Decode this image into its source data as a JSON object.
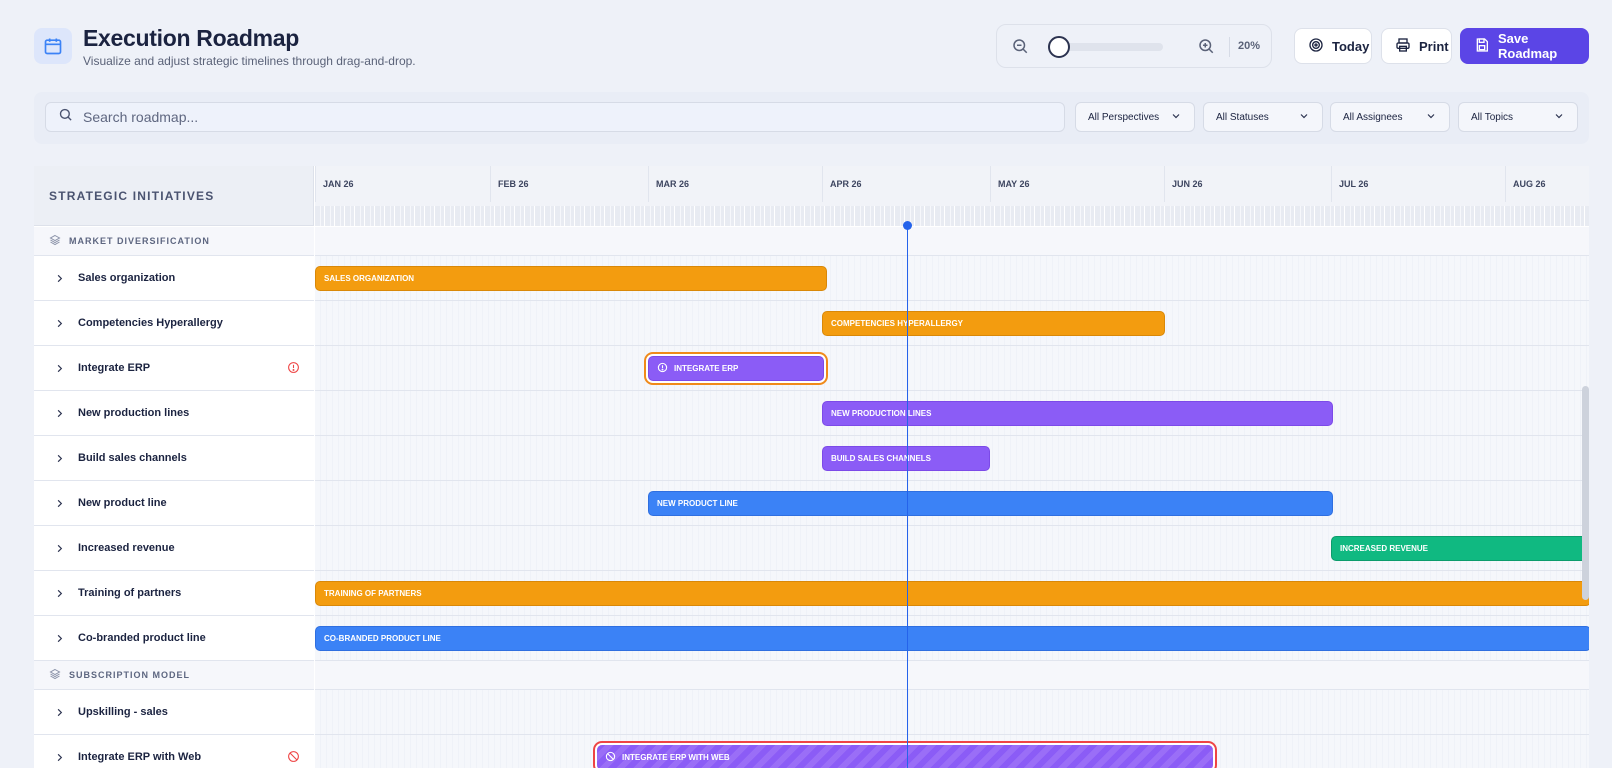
{
  "header": {
    "title": "Execution Roadmap",
    "subtitle": "Visualize and adjust strategic timelines through drag-and-drop."
  },
  "zoom": {
    "value_label": "20%",
    "level": 0.2
  },
  "actions": {
    "today": "Today",
    "print": "Print",
    "save": "Save Roadmap"
  },
  "search": {
    "placeholder": "Search roadmap...",
    "value": ""
  },
  "filters": [
    {
      "label": "All Perspectives"
    },
    {
      "label": "All Statuses"
    },
    {
      "label": "All Assignees"
    },
    {
      "label": "All Topics"
    }
  ],
  "gantt": {
    "left_header": "STRATEGIC INITIATIVES",
    "months": [
      "JAN 26",
      "FEB 26",
      "MAR 26",
      "APR 26",
      "MAY 26",
      "JUN 26",
      "JUL 26",
      "AUG 26"
    ],
    "groups": [
      {
        "name": "MARKET DIVERSIFICATION",
        "rows": [
          {
            "name": "Sales organization",
            "bar_label": "SALES ORGANIZATION",
            "color": "#f39c0f",
            "status": ""
          },
          {
            "name": "Competencies Hyperallergy",
            "bar_label": "COMPETENCIES HYPERALLERGY",
            "color": "#f39c0f",
            "status": ""
          },
          {
            "name": "Integrate ERP",
            "bar_label": "INTEGRATE ERP",
            "color": "#8b5cf6",
            "status": "at-risk"
          },
          {
            "name": "New production lines",
            "bar_label": "NEW PRODUCTION LINES",
            "color": "#8b5cf6",
            "status": ""
          },
          {
            "name": "Build sales channels",
            "bar_label": "BUILD SALES CHANNELS",
            "color": "#8b5cf6",
            "status": ""
          },
          {
            "name": "New product line",
            "bar_label": "NEW PRODUCT LINE",
            "color": "#3b82f6",
            "status": ""
          },
          {
            "name": "Increased revenue",
            "bar_label": "INCREASED REVENUE",
            "color": "#10b981",
            "status": ""
          },
          {
            "name": "Training of partners",
            "bar_label": "TRAINING OF PARTNERS",
            "color": "#f39c0f",
            "status": ""
          },
          {
            "name": "Co-branded product line",
            "bar_label": "CO-BRANDED PRODUCT LINE",
            "color": "#3b82f6",
            "status": ""
          }
        ]
      },
      {
        "name": "SUBSCRIPTION MODEL",
        "rows": [
          {
            "name": "Upskilling - sales",
            "bar_label": "",
            "color": "",
            "status": ""
          },
          {
            "name": "Integrate ERP with Web",
            "bar_label": "INTEGRATE ERP WITH WEB",
            "color": "#8b5cf6",
            "status": "blocked"
          }
        ]
      }
    ]
  },
  "colors": {
    "accent": "#5b45e6",
    "today_marker": "#2563eb",
    "at_risk_outline": "#f08a1a",
    "blocked_outline": "#ee4444"
  }
}
